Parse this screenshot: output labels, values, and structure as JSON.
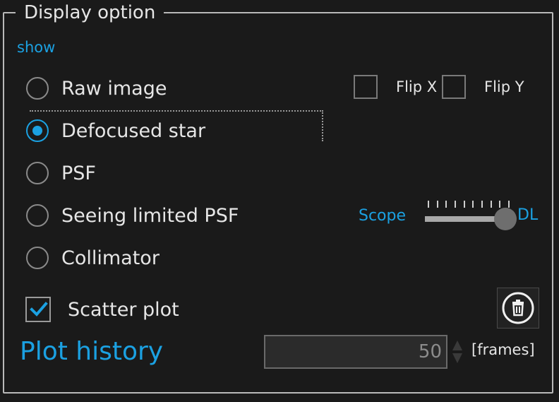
{
  "group": {
    "title": "Display option"
  },
  "show_link": "show",
  "display_modes": [
    {
      "label": "Raw image",
      "checked": false
    },
    {
      "label": "Defocused star",
      "checked": true
    },
    {
      "label": "PSF",
      "checked": false
    },
    {
      "label": "Seeing limited PSF",
      "checked": false
    },
    {
      "label": "Collimator",
      "checked": false
    }
  ],
  "flip": {
    "x_label": "Flip X",
    "x_checked": false,
    "y_label": "Flip Y",
    "y_checked": false
  },
  "slider": {
    "left_label": "Scope",
    "right_label": "DL",
    "value_fraction": 1.0,
    "tick_count": 10
  },
  "scatter": {
    "label": "Scatter plot",
    "checked": true
  },
  "icons": {
    "clear": "trash-icon",
    "check": "check-icon",
    "spin_up": "arrow-up-icon",
    "spin_down": "arrow-down-icon"
  },
  "plot_history": {
    "label": "Plot history",
    "value": "50",
    "unit": "[frames]"
  },
  "colors": {
    "accent": "#1ba1e2",
    "background": "#1a1a1a",
    "text": "#e6e6e6",
    "border": "#b9b9b9"
  }
}
